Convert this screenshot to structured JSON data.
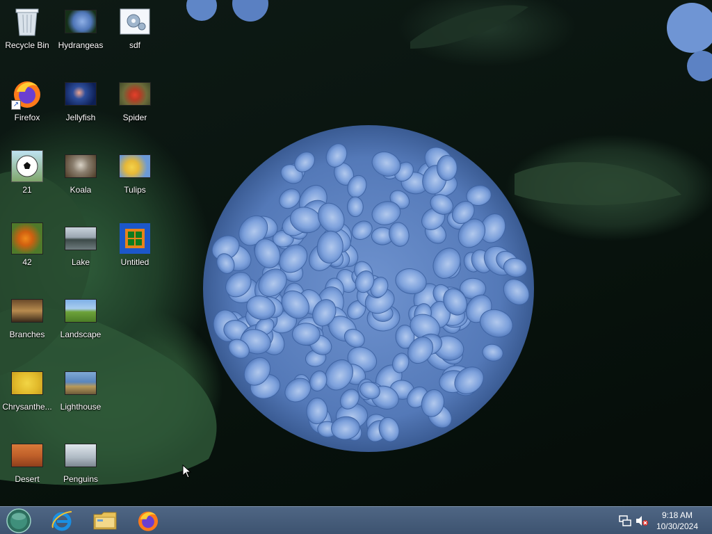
{
  "desktop": {
    "icons": [
      {
        "label": "Recycle Bin",
        "icon": "recycle-bin-icon"
      },
      {
        "label": "Hydrangeas",
        "icon": "image-icon"
      },
      {
        "label": "sdf",
        "icon": "settings-file-icon"
      },
      {
        "label": "Firefox",
        "icon": "firefox-icon"
      },
      {
        "label": "Jellyfish",
        "icon": "image-icon"
      },
      {
        "label": "Spider",
        "icon": "image-icon"
      },
      {
        "label": "21",
        "icon": "soccer-ball-icon"
      },
      {
        "label": "Koala",
        "icon": "image-icon"
      },
      {
        "label": "Tulips",
        "icon": "image-icon"
      },
      {
        "label": "42",
        "icon": "image-icon"
      },
      {
        "label": "Lake",
        "icon": "image-icon"
      },
      {
        "label": "Untitled",
        "icon": "window-app-icon"
      },
      {
        "label": "Branches",
        "icon": "image-icon"
      },
      {
        "label": "Landscape",
        "icon": "image-icon"
      },
      {
        "label": "Chrysanthe...",
        "icon": "image-icon"
      },
      {
        "label": "Lighthouse",
        "icon": "image-icon"
      },
      {
        "label": "Desert",
        "icon": "image-icon"
      },
      {
        "label": "Penguins",
        "icon": "image-icon"
      }
    ]
  },
  "taskbar": {
    "start": "start-orb-icon",
    "pinned": [
      "internet-explorer-icon",
      "file-explorer-icon",
      "firefox-icon"
    ],
    "tray": [
      "network-icon",
      "volume-muted-icon"
    ],
    "time": "9:18 AM",
    "date": "10/30/2024"
  },
  "colors": {
    "taskbar": "#465c79",
    "hydrangea": "#7fa3de",
    "leaf": "#2f5d3a"
  }
}
